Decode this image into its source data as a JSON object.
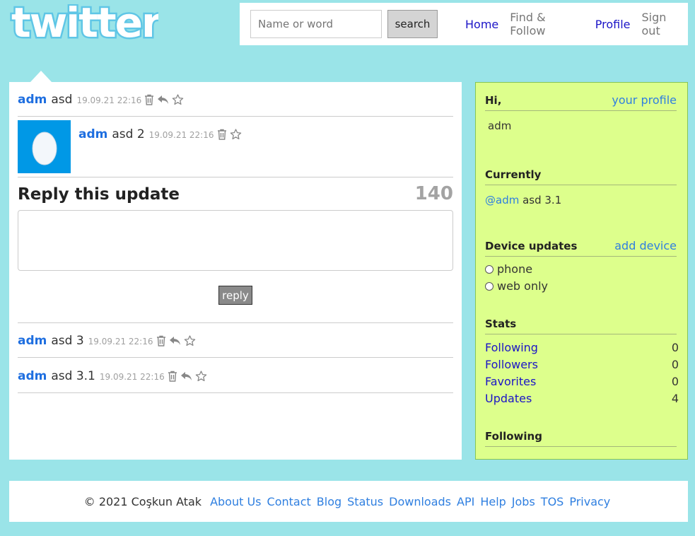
{
  "brand": {
    "logo_text": "twitter"
  },
  "search": {
    "placeholder": "Name or word",
    "value": "",
    "button_label": "search"
  },
  "nav": {
    "home": "Home",
    "find_follow": "Find & Follow",
    "profile": "Profile",
    "sign_out": "Sign out"
  },
  "main": {
    "parent_tweet": {
      "user": "adm",
      "text": "asd",
      "time": "19.09.21 22:16"
    },
    "featured_tweet": {
      "user": "adm",
      "text": "asd 2",
      "time": "19.09.21 22:16"
    },
    "reply": {
      "title": "Reply this update",
      "counter": "140",
      "text": "",
      "button_label": "reply"
    },
    "replies": [
      {
        "user": "adm",
        "text": "asd 3",
        "time": "19.09.21 22:16"
      },
      {
        "user": "adm",
        "text": "asd 3.1",
        "time": "19.09.21 22:16"
      }
    ]
  },
  "sidebar": {
    "greeting": {
      "title": "Hi,",
      "link": "your profile",
      "username": "adm"
    },
    "currently": {
      "title": "Currently",
      "mention": "@adm",
      "text": " asd 3.1"
    },
    "device": {
      "title": "Device updates",
      "link": "add device",
      "options": [
        "phone",
        "web only"
      ]
    },
    "stats": {
      "title": "Stats",
      "rows": [
        {
          "label": "Following",
          "value": "0"
        },
        {
          "label": "Followers",
          "value": "0"
        },
        {
          "label": "Favorites",
          "value": "0"
        },
        {
          "label": "Updates",
          "value": "4"
        }
      ]
    },
    "following": {
      "title": "Following"
    }
  },
  "footer": {
    "copyright": "© 2021 Coşkun Atak",
    "links": [
      "About Us",
      "Contact",
      "Blog",
      "Status",
      "Downloads",
      "API",
      "Help",
      "Jobs",
      "TOS",
      "Privacy"
    ]
  },
  "colors": {
    "background": "#9ae4e8",
    "sidebar": "#ddff8c",
    "link": "#1f6fe0",
    "nav_active": "#1b14c7",
    "avatar": "#0098e6"
  }
}
